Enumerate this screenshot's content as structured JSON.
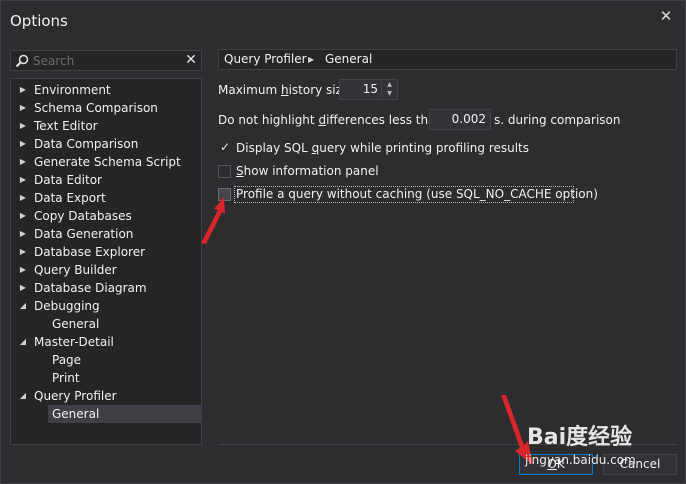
{
  "window": {
    "title": "Options"
  },
  "search": {
    "placeholder": "Search"
  },
  "tree": {
    "items": [
      {
        "label": "Environment",
        "expandable": true,
        "expanded": false,
        "level": 0
      },
      {
        "label": "Schema Comparison",
        "expandable": true,
        "expanded": false,
        "level": 0
      },
      {
        "label": "Text Editor",
        "expandable": true,
        "expanded": false,
        "level": 0
      },
      {
        "label": "Data Comparison",
        "expandable": true,
        "expanded": false,
        "level": 0
      },
      {
        "label": "Generate Schema Script",
        "expandable": true,
        "expanded": false,
        "level": 0
      },
      {
        "label": "Data Editor",
        "expandable": true,
        "expanded": false,
        "level": 0
      },
      {
        "label": "Data Export",
        "expandable": true,
        "expanded": false,
        "level": 0
      },
      {
        "label": "Copy Databases",
        "expandable": true,
        "expanded": false,
        "level": 0
      },
      {
        "label": "Data Generation",
        "expandable": true,
        "expanded": false,
        "level": 0
      },
      {
        "label": "Database Explorer",
        "expandable": true,
        "expanded": false,
        "level": 0
      },
      {
        "label": "Query Builder",
        "expandable": true,
        "expanded": false,
        "level": 0
      },
      {
        "label": "Database Diagram",
        "expandable": true,
        "expanded": false,
        "level": 0
      },
      {
        "label": "Debugging",
        "expandable": true,
        "expanded": true,
        "level": 0
      },
      {
        "label": "General",
        "expandable": false,
        "expanded": false,
        "level": 1
      },
      {
        "label": "Master-Detail",
        "expandable": true,
        "expanded": true,
        "level": 0
      },
      {
        "label": "Page",
        "expandable": false,
        "expanded": false,
        "level": 1
      },
      {
        "label": "Print",
        "expandable": false,
        "expanded": false,
        "level": 1
      },
      {
        "label": "Query Profiler",
        "expandable": true,
        "expanded": true,
        "level": 0
      },
      {
        "label": "General",
        "expandable": false,
        "expanded": false,
        "level": 1,
        "selected": true
      }
    ]
  },
  "breadcrumb": {
    "parent": "Query Profiler",
    "current": "General"
  },
  "settings": {
    "history_label_pre": "Maximum ",
    "history_label_u": "h",
    "history_label_post": "istory size:",
    "history_value": "15",
    "diff_label_pre": "Do not highlight ",
    "diff_label_u": "d",
    "diff_label_post": "ifferences less than",
    "diff_value": "0.002",
    "diff_suffix": "s. during comparison",
    "display_sql_pre": "Display SQL ",
    "display_sql_u": "q",
    "display_sql_post": "uery while printing profiling results",
    "display_sql_checked": true,
    "show_info_u": "S",
    "show_info_post": "how information panel",
    "show_info_checked": false,
    "no_cache_label": "Profile a query without caching (use SQL_NO_CACHE option)",
    "no_cache_checked": false
  },
  "buttons": {
    "ok_u": "O",
    "ok_post": "K",
    "cancel": "Cancel"
  },
  "watermark": {
    "brand": "Bai度经验",
    "url": "jingyan.baidu.com"
  },
  "colors": {
    "annotation_arrow": "#d9262b",
    "accent": "#007acc"
  }
}
